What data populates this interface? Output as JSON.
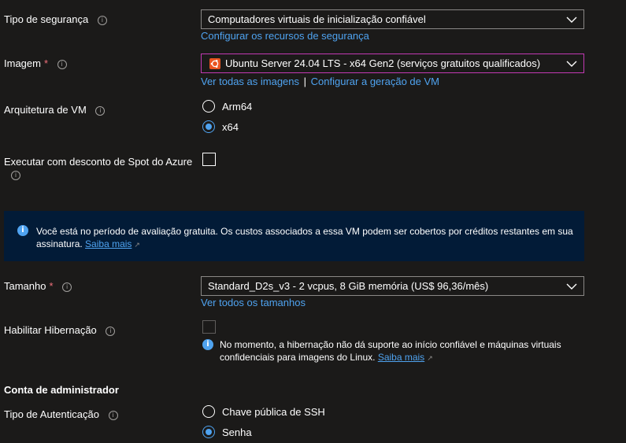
{
  "security": {
    "label": "Tipo de segurança",
    "value": "Computadores virtuais de inicialização confiável",
    "link": "Configurar os recursos de segurança"
  },
  "image": {
    "label": "Imagem",
    "required": "*",
    "value": "Ubuntu Server 24.04 LTS - x64 Gen2 (serviços gratuitos qualificados)",
    "link_all": "Ver todas as imagens",
    "separator": "|",
    "link_generation": "Configurar a geração de VM"
  },
  "architecture": {
    "label": "Arquitetura de VM",
    "options": [
      "Arm64",
      "x64"
    ],
    "selected": "x64"
  },
  "spot": {
    "label": "Executar com desconto de Spot do Azure",
    "checked": false
  },
  "trial_banner": {
    "text": "Você está no período de avaliação gratuita. Os custos associados a essa VM podem ser cobertos por créditos restantes em sua",
    "text2": "assinatura.",
    "link": "Saiba mais"
  },
  "size": {
    "label": "Tamanho",
    "required": "*",
    "value": "Standard_D2s_v3 - 2 vcpus, 8 GiB memória (US$ 96,36/mês)",
    "link": "Ver todos os tamanhos"
  },
  "hibernation": {
    "label": "Habilitar Hibernação",
    "checked": false,
    "note_line1": "No momento, a hibernação não dá suporte ao início confiável e máquinas virtuais",
    "note_line2": "confidenciais para imagens do Linux.",
    "note_link": "Saiba mais"
  },
  "admin": {
    "heading": "Conta de administrador",
    "auth_label": "Tipo de Autenticação",
    "options": [
      "Chave pública de SSH",
      "Senha"
    ],
    "selected": "Senha"
  },
  "colors": {
    "background": "#1b1a19",
    "link": "#4fa3f0",
    "banner": "#021b37",
    "required": "#f1707b",
    "focus_border": "#c239b3",
    "ubuntu": "#e95420"
  }
}
